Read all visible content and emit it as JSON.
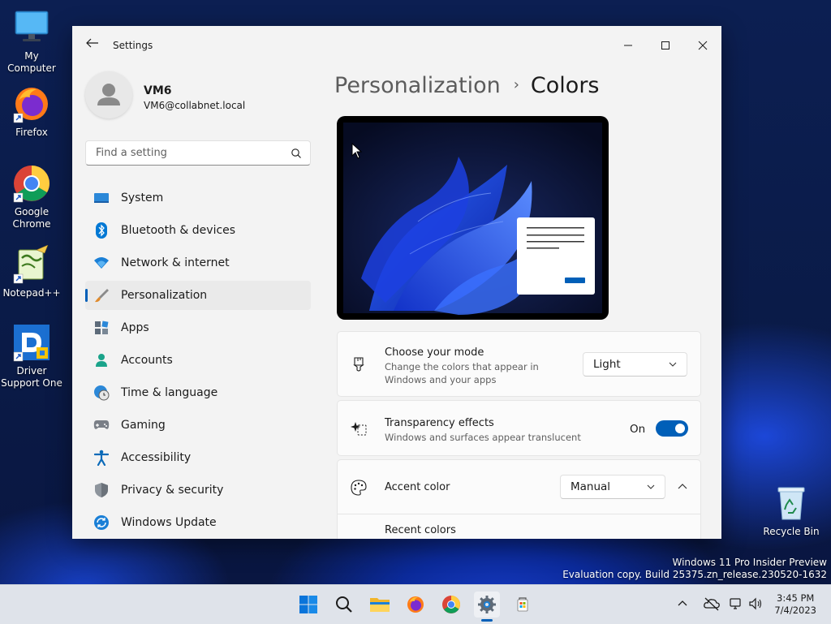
{
  "desktop": {
    "icons": [
      {
        "label": "My Computer"
      },
      {
        "label": "Firefox"
      },
      {
        "label": "Google Chrome"
      },
      {
        "label": "Notepad++"
      },
      {
        "label": "Driver Support One"
      },
      {
        "label": "Recycle Bin"
      }
    ],
    "watermark": {
      "line1": "Windows 11 Pro Insider Preview",
      "line2": "Evaluation copy. Build 25375.zn_release.230520-1632"
    }
  },
  "window": {
    "app_title": "Settings",
    "controls": {
      "minimize": "minimize",
      "maximize": "maximize",
      "close": "close"
    }
  },
  "profile": {
    "name": "VM6",
    "email": "VM6@collabnet.local"
  },
  "search": {
    "placeholder": "Find a setting"
  },
  "nav": {
    "items": [
      {
        "label": "System",
        "icon": "system-icon"
      },
      {
        "label": "Bluetooth & devices",
        "icon": "bluetooth-icon"
      },
      {
        "label": "Network & internet",
        "icon": "wifi-icon"
      },
      {
        "label": "Personalization",
        "icon": "brush-icon",
        "active": true
      },
      {
        "label": "Apps",
        "icon": "apps-icon"
      },
      {
        "label": "Accounts",
        "icon": "accounts-icon"
      },
      {
        "label": "Time & language",
        "icon": "globe-clock-icon"
      },
      {
        "label": "Gaming",
        "icon": "gamepad-icon"
      },
      {
        "label": "Accessibility",
        "icon": "accessibility-icon"
      },
      {
        "label": "Privacy & security",
        "icon": "shield-icon"
      },
      {
        "label": "Windows Update",
        "icon": "update-icon"
      }
    ]
  },
  "breadcrumb": {
    "parent": "Personalization",
    "separator": "›",
    "current": "Colors"
  },
  "mode": {
    "title": "Choose your mode",
    "description": "Change the colors that appear in Windows and your apps",
    "value": "Light"
  },
  "transparency": {
    "title": "Transparency effects",
    "description": "Windows and surfaces appear translucent",
    "state_label": "On",
    "enabled": true
  },
  "accent": {
    "title": "Accent color",
    "value": "Manual",
    "recent_label": "Recent colors"
  },
  "taskbar": {
    "clock_time": "3:45 PM",
    "clock_date": "7/4/2023"
  },
  "colors": {
    "accent": "#005fb8",
    "window_bg": "#f3f3f3"
  }
}
